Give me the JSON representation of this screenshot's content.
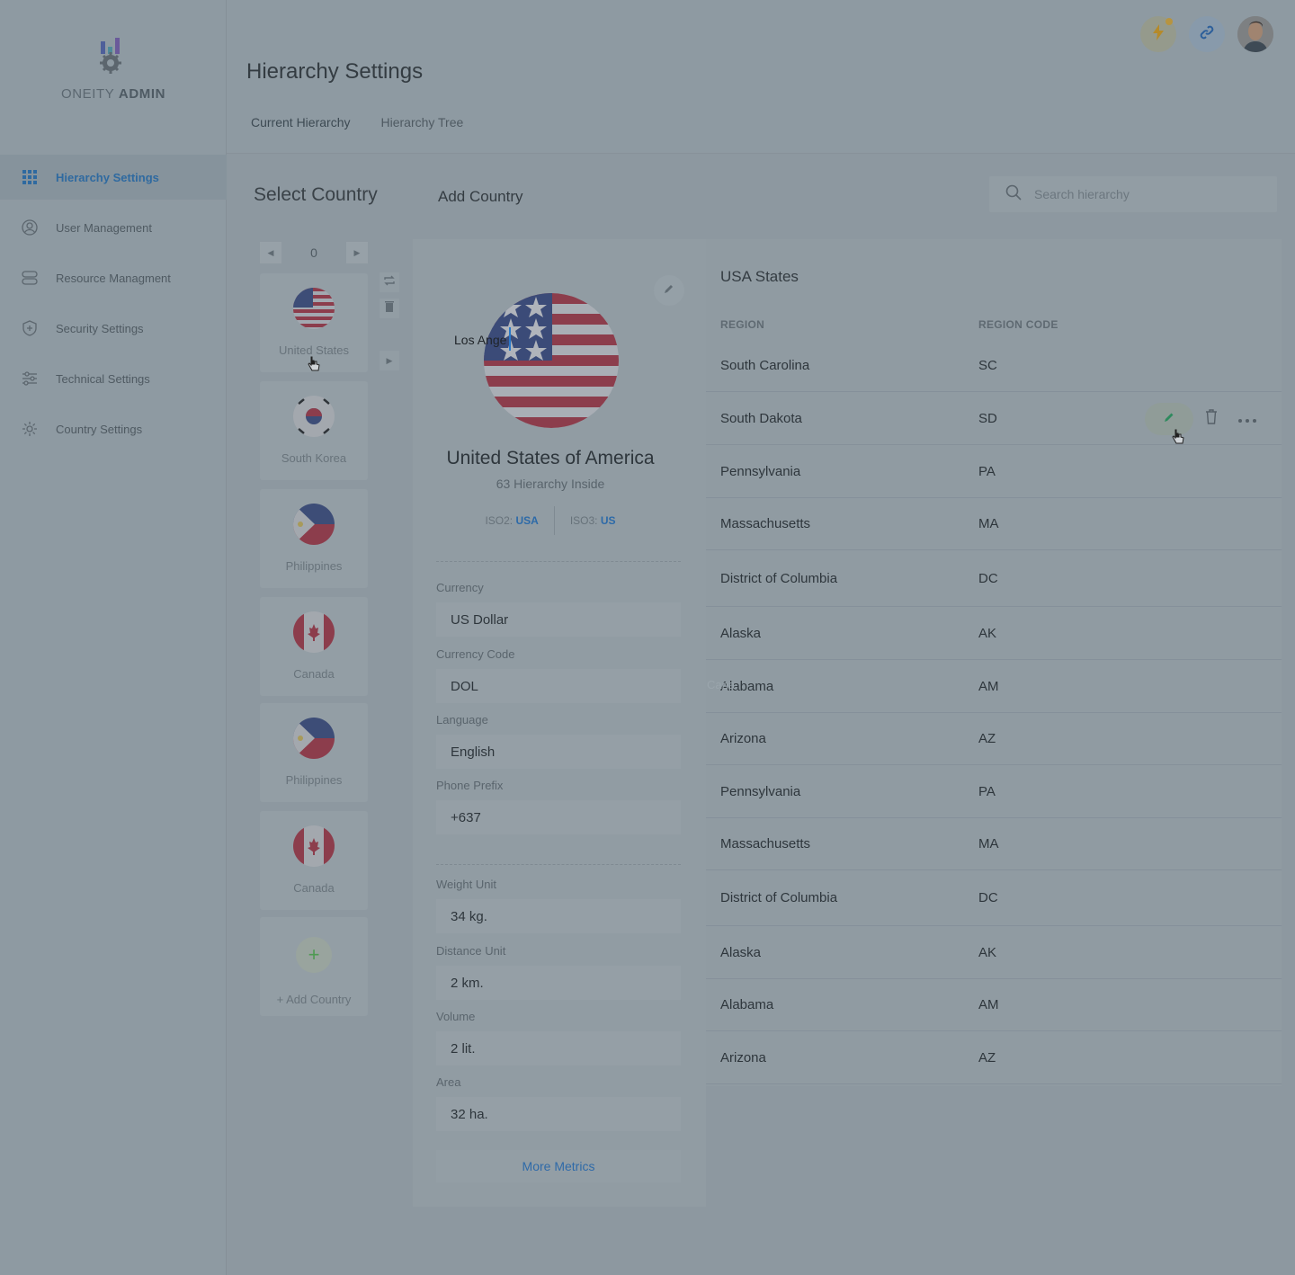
{
  "brand": {
    "name_light": "ONEITY",
    "name_bold": "ADMIN"
  },
  "sidebar": {
    "items": [
      {
        "label": "Hierarchy Settings",
        "icon": "grid-icon",
        "active": true
      },
      {
        "label": "User Management",
        "icon": "user-circle-icon"
      },
      {
        "label": "Resource Managment",
        "icon": "stack-icon"
      },
      {
        "label": "Security Settings",
        "icon": "shield-icon"
      },
      {
        "label": "Technical Settings",
        "icon": "sliders-icon"
      },
      {
        "label": "Country Settings",
        "icon": "gear-icon"
      }
    ]
  },
  "header": {
    "title": "Hierarchy Settings",
    "tabs": [
      {
        "label": "Current Hierarchy",
        "active": true
      },
      {
        "label": "Hierarchy Tree"
      }
    ],
    "icons": [
      "bolt-icon",
      "link-icon",
      "avatar"
    ]
  },
  "countries": {
    "title": "Select Country",
    "page": "0",
    "items": [
      {
        "name": "United States",
        "flag": "us-flag-icon"
      },
      {
        "name": "South Korea",
        "flag": "kr-flag-icon"
      },
      {
        "name": "Philippines",
        "flag": "ph-flag-icon"
      },
      {
        "name": "Canada",
        "flag": "ca-flag-icon"
      },
      {
        "name": "Philippines",
        "flag": "ph-flag-icon"
      },
      {
        "name": "Canada",
        "flag": "ca-flag-icon"
      }
    ],
    "add_label": "+ Add Country"
  },
  "detail": {
    "header": "Add Country",
    "map_label": "Los Ange",
    "country_name": "United States of America",
    "hierarchy_count": "63 Hierarchy Inside",
    "iso2_label": "ISO2:",
    "iso2_value": "USA",
    "iso3_label": "ISO3:",
    "iso3_value": "US",
    "fields": [
      {
        "label": "Currency",
        "value": "US Dollar"
      },
      {
        "label": "Currency Code",
        "value": "DOL"
      },
      {
        "label": "Language",
        "value": "English"
      },
      {
        "label": "Phone Prefix",
        "value": "+637"
      },
      {
        "label": "Weight Unit",
        "value": "34 kg."
      },
      {
        "label": "Distance Unit",
        "value": "2 km."
      },
      {
        "label": "Volume",
        "value": "2 lit."
      },
      {
        "label": "Area",
        "value": "32  ha."
      }
    ],
    "more_metrics": "More Metrics"
  },
  "search": {
    "placeholder": "Search hierarchy"
  },
  "states_table": {
    "title": "USA States",
    "columns": [
      "REGION",
      "REGION CODE"
    ],
    "rows": [
      [
        "South Carolina",
        "SC"
      ],
      [
        "South Dakota",
        "SD"
      ],
      [
        "Pennsylvania",
        "PA"
      ],
      [
        "Massachusetts",
        "MA"
      ],
      [
        "District of Columbia",
        "DC"
      ],
      [
        "Alaska",
        "AK"
      ],
      [
        "Alabama",
        "AM"
      ],
      [
        "Arizona",
        "AZ"
      ],
      [
        "Pennsylvania",
        "PA"
      ],
      [
        "Massachusetts",
        "MA"
      ],
      [
        "District of Columbia",
        "DC"
      ],
      [
        "Alaska",
        "AK"
      ],
      [
        "Alabama",
        "AM"
      ],
      [
        "Arizona",
        "AZ"
      ]
    ],
    "row_actions": [
      "edit-icon",
      "trash-icon",
      "more-icon"
    ]
  },
  "ghost_text": "Cana",
  "colors": {
    "accent": "#3a7bb4",
    "overlay": "#8e9aa2",
    "add_green": "#4e9a52"
  }
}
